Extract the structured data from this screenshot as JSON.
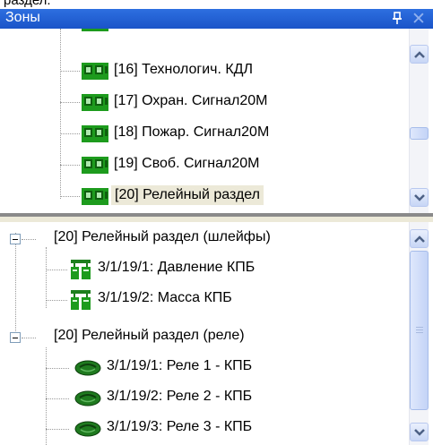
{
  "clipped_header": "раздел.",
  "panel": {
    "title": "Зоны",
    "pin_icon": "pin-icon",
    "close_icon": "close-icon"
  },
  "zones": {
    "items": [
      {
        "label": "[16] Технологич. КДЛ"
      },
      {
        "label": "[17] Охран. Сигнал20М"
      },
      {
        "label": "[18] Пожар. Сигнал20М"
      },
      {
        "label": "[19] Своб. Сигнал20М"
      },
      {
        "label": "[20] Релейный раздел",
        "selected": true
      }
    ]
  },
  "details": {
    "groups": [
      {
        "label": "[20] Релейный раздел (шлейфы)",
        "expander": "−",
        "children": [
          {
            "label": "3/1/19/1: Давление КПБ",
            "icon": "loop-icon"
          },
          {
            "label": "3/1/19/2: Масса КПБ",
            "icon": "loop-icon"
          }
        ]
      },
      {
        "label": "[20] Релейный раздел (реле)",
        "expander": "−",
        "children": [
          {
            "label": "3/1/19/1: Реле 1 - КПБ",
            "icon": "relay-icon"
          },
          {
            "label": "3/1/19/2: Реле 2 - КПБ",
            "icon": "relay-icon"
          },
          {
            "label": "3/1/19/3: Реле 3 - КПБ",
            "icon": "relay-icon"
          }
        ]
      }
    ]
  },
  "colors": {
    "titlebar": "#1a54c8",
    "zone_icon_green": "#1d9b1d",
    "relay_icon_green": "#1f7a1f",
    "selection": "#ece9d8"
  }
}
